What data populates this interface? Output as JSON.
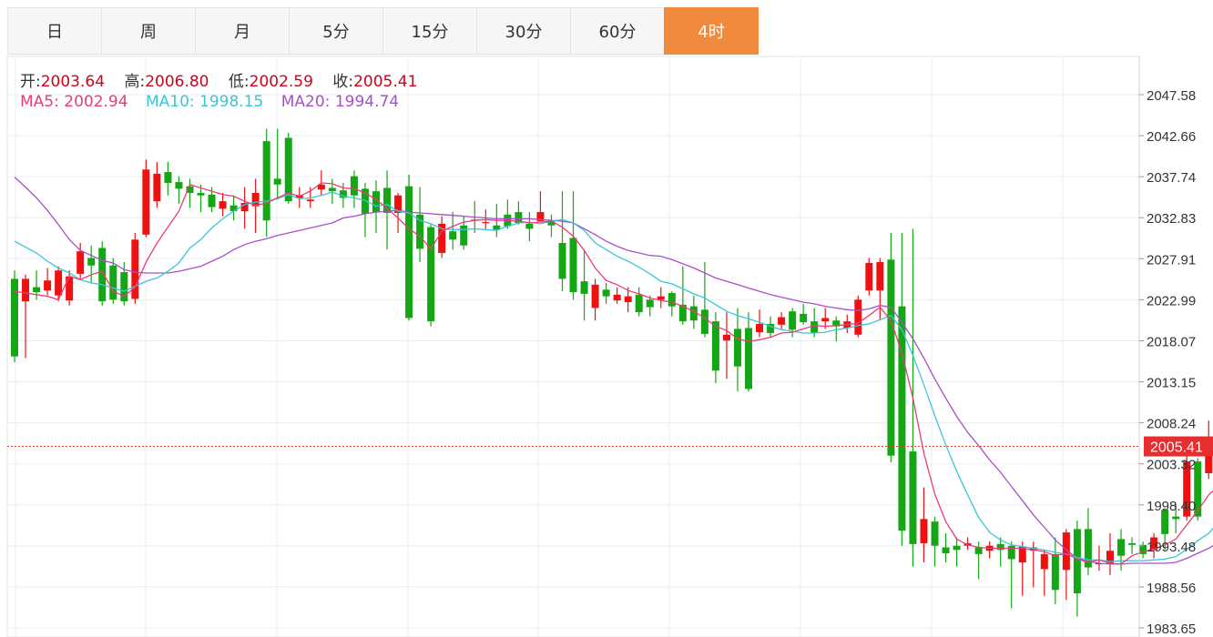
{
  "tabs": [
    {
      "label": "日",
      "active": false
    },
    {
      "label": "周",
      "active": false
    },
    {
      "label": "月",
      "active": false
    },
    {
      "label": "5分",
      "active": false
    },
    {
      "label": "15分",
      "active": false
    },
    {
      "label": "30分",
      "active": false
    },
    {
      "label": "60分",
      "active": false
    },
    {
      "label": "4时",
      "active": true
    }
  ],
  "ohlc_info": {
    "open_label": "开:",
    "open": "2003.64",
    "high_label": "高:",
    "high": "2006.80",
    "low_label": "低:",
    "low": "2002.59",
    "close_label": "收:",
    "close": "2005.41"
  },
  "ma_info": {
    "ma5_label": "MA5:",
    "ma5": "2002.94",
    "ma10_label": "MA10:",
    "ma10": "1998.15",
    "ma20_label": "MA20:",
    "ma20": "1994.74"
  },
  "colors": {
    "up": "#ee1111",
    "down": "#14a614",
    "ma5": "#ea3c7a",
    "ma10": "#39c6dc",
    "ma20": "#a94fc8",
    "accent": "#f08a3c",
    "price_line": "#e8432e"
  },
  "chart_data": {
    "type": "candlestick",
    "y_ticks": [
      "2047.58",
      "2042.66",
      "2037.74",
      "2032.83",
      "2027.91",
      "2022.99",
      "2018.07",
      "2013.15",
      "2008.24",
      "2003.32",
      "1998.40",
      "1993.48",
      "1988.56",
      "1983.65"
    ],
    "ylim": [
      1983.65,
      2047.58
    ],
    "current_price": "2005.41",
    "candles": [
      [
        2025.5,
        2016.2,
        2026.5,
        2015.5
      ],
      [
        2022.8,
        2025.5,
        2026.0,
        2016.0
      ],
      [
        2024.5,
        2023.9,
        2026.5,
        2023.0
      ],
      [
        2024.1,
        2025.3,
        2026.8,
        2023.5
      ],
      [
        2023.5,
        2026.5,
        2027.0,
        2022.8
      ],
      [
        2022.9,
        2025.8,
        2026.5,
        2022.3
      ],
      [
        2026.1,
        2028.8,
        2029.8,
        2025.5
      ],
      [
        2028.0,
        2027.1,
        2029.5,
        2025.0
      ],
      [
        2029.2,
        2022.8,
        2030.0,
        2022.3
      ],
      [
        2027.1,
        2023.0,
        2028.0,
        2022.5
      ],
      [
        2026.3,
        2022.8,
        2027.5,
        2022.3
      ],
      [
        2023.1,
        2030.2,
        2031.0,
        2022.5
      ],
      [
        2030.8,
        2038.6,
        2039.8,
        2030.5
      ],
      [
        2034.8,
        2038.1,
        2039.5,
        2034.0
      ],
      [
        2038.3,
        2037.0,
        2039.5,
        2035.5
      ],
      [
        2037.1,
        2036.3,
        2037.8,
        2034.5
      ],
      [
        2036.6,
        2035.8,
        2037.5,
        2034.0
      ],
      [
        2035.8,
        2035.5,
        2036.8,
        2033.5
      ],
      [
        2035.6,
        2034.1,
        2036.5,
        2033.5
      ],
      [
        2033.9,
        2034.8,
        2035.8,
        2033.0
      ],
      [
        2034.3,
        2033.6,
        2035.5,
        2032.5
      ],
      [
        2033.6,
        2034.6,
        2036.5,
        2031.5
      ],
      [
        2034.2,
        2035.8,
        2037.5,
        2031.0
      ],
      [
        2042.0,
        2032.5,
        2043.5,
        2030.5
      ],
      [
        2037.5,
        2036.8,
        2043.5,
        2035.0
      ],
      [
        2042.4,
        2034.8,
        2043.0,
        2034.5
      ],
      [
        2035.2,
        2035.5,
        2036.5,
        2034.0
      ],
      [
        2034.8,
        2035.0,
        2036.5,
        2034.0
      ],
      [
        2036.2,
        2036.8,
        2038.5,
        2035.5
      ],
      [
        2036.4,
        2036.0,
        2037.5,
        2034.5
      ],
      [
        2036.1,
        2035.2,
        2037.0,
        2034.0
      ],
      [
        2037.8,
        2035.5,
        2038.5,
        2034.0
      ],
      [
        2036.3,
        2033.3,
        2037.0,
        2030.5
      ],
      [
        2036.0,
        2033.5,
        2037.3,
        2031.0
      ],
      [
        2036.4,
        2033.4,
        2038.5,
        2029.0
      ],
      [
        2033.4,
        2035.5,
        2035.8,
        2031.0
      ],
      [
        2036.6,
        2020.8,
        2038.0,
        2020.5
      ],
      [
        2033.2,
        2029.1,
        2036.5,
        2027.5
      ],
      [
        2031.7,
        2020.4,
        2032.0,
        2019.8
      ],
      [
        2028.6,
        2032.1,
        2033.0,
        2028.0
      ],
      [
        2031.2,
        2030.2,
        2033.5,
        2029.0
      ],
      [
        2031.9,
        2029.5,
        2033.0,
        2029.0
      ],
      [
        2032.6,
        2032.5,
        2034.8,
        2031.0
      ],
      [
        2032.2,
        2032.3,
        2033.8,
        2031.5
      ],
      [
        2031.9,
        2031.4,
        2034.5,
        2030.5
      ],
      [
        2033.2,
        2031.8,
        2035.0,
        2031.5
      ],
      [
        2033.5,
        2032.2,
        2034.8,
        2032.0
      ],
      [
        2032.1,
        2031.5,
        2033.5,
        2030.0
      ],
      [
        2032.4,
        2033.5,
        2036.0,
        2032.5
      ],
      [
        2032.4,
        2031.9,
        2033.2,
        2030.5
      ],
      [
        2029.8,
        2025.5,
        2036.0,
        2024.0
      ],
      [
        2030.4,
        2023.9,
        2036.0,
        2023.0
      ],
      [
        2025.2,
        2023.7,
        2029.0,
        2020.5
      ],
      [
        2022.0,
        2024.8,
        2025.5,
        2020.5
      ],
      [
        2024.2,
        2023.4,
        2025.0,
        2022.5
      ],
      [
        2022.9,
        2023.6,
        2024.5,
        2022.5
      ],
      [
        2022.7,
        2023.4,
        2024.5,
        2021.5
      ],
      [
        2023.6,
        2021.5,
        2024.5,
        2021.0
      ],
      [
        2023.0,
        2022.1,
        2023.5,
        2021.0
      ],
      [
        2023.0,
        2023.4,
        2024.5,
        2022.0
      ],
      [
        2023.8,
        2022.2,
        2024.0,
        2021.0
      ],
      [
        2022.4,
        2020.4,
        2027.0,
        2020.0
      ],
      [
        2022.2,
        2020.5,
        2023.5,
        2019.5
      ],
      [
        2021.8,
        2018.9,
        2027.5,
        2018.5
      ],
      [
        2020.4,
        2014.5,
        2021.5,
        2013.0
      ],
      [
        2018.1,
        2018.8,
        2021.5,
        2013.5
      ],
      [
        2019.5,
        2015.0,
        2022.0,
        2012.0
      ],
      [
        2019.6,
        2012.3,
        2021.5,
        2012.0
      ],
      [
        2019.1,
        2020.1,
        2021.8,
        2018.5
      ],
      [
        2020.1,
        2019.0,
        2021.0,
        2018.5
      ],
      [
        2020.0,
        2020.9,
        2021.5,
        2019.5
      ],
      [
        2021.6,
        2019.4,
        2022.0,
        2018.5
      ],
      [
        2021.3,
        2020.3,
        2022.5,
        2020.0
      ],
      [
        2020.4,
        2019.0,
        2022.0,
        2018.5
      ],
      [
        2020.4,
        2020.8,
        2022.0,
        2019.5
      ],
      [
        2020.5,
        2019.8,
        2021.0,
        2018.0
      ],
      [
        2019.6,
        2020.4,
        2021.2,
        2019.0
      ],
      [
        2018.8,
        2023.0,
        2023.5,
        2018.5
      ],
      [
        2024.1,
        2027.4,
        2028.0,
        2023.5
      ],
      [
        2024.1,
        2027.5,
        2028.0,
        2020.5
      ],
      [
        2027.8,
        2004.3,
        2031.0,
        2003.5
      ],
      [
        2022.2,
        1995.3,
        2031.0,
        1993.5
      ],
      [
        2004.8,
        1993.7,
        2031.5,
        1991.0
      ],
      [
        1993.8,
        1996.7,
        2000.5,
        1991.5
      ],
      [
        1996.4,
        1993.5,
        1997.0,
        1991.0
      ],
      [
        1993.3,
        1992.6,
        1995.0,
        1991.5
      ],
      [
        1993.5,
        1993.0,
        1994.5,
        1991.0
      ],
      [
        1993.5,
        1993.8,
        1994.5,
        1993.0
      ],
      [
        1993.3,
        1992.5,
        1994.0,
        1989.5
      ],
      [
        1992.9,
        1993.5,
        1994.0,
        1992.0
      ],
      [
        1993.7,
        1993.0,
        1994.5,
        1991.0
      ],
      [
        1993.5,
        1991.9,
        1994.0,
        1986.0
      ],
      [
        1991.5,
        1993.4,
        1994.0,
        1987.5
      ],
      [
        1992.9,
        1993.3,
        1994.0,
        1988.5
      ],
      [
        1990.7,
        1992.5,
        1993.0,
        1987.5
      ],
      [
        1992.5,
        1988.2,
        1994.5,
        1986.5
      ],
      [
        1990.6,
        1995.1,
        1995.5,
        1987.0
      ],
      [
        1995.5,
        1987.8,
        1996.5,
        1985.0
      ],
      [
        1995.5,
        1990.9,
        1998.0,
        1990.0
      ],
      [
        1991.3,
        1991.4,
        1993.5,
        1990.5
      ],
      [
        1991.3,
        1992.9,
        1995.0,
        1990.0
      ],
      [
        1994.3,
        1992.3,
        1995.5,
        1990.5
      ],
      [
        1993.8,
        1993.6,
        1994.5,
        1992.5
      ],
      [
        1993.6,
        1992.5,
        1994.0,
        1992.0
      ],
      [
        1993.0,
        1994.5,
        1995.0,
        1992.0
      ],
      [
        1997.8,
        1994.9,
        1998.0,
        1993.0
      ],
      [
        1997.0,
        1996.7,
        1998.5,
        1995.0
      ],
      [
        1997.0,
        2003.6,
        2004.5,
        1996.5
      ],
      [
        2003.6,
        1997.0,
        2004.0,
        1996.5
      ],
      [
        2002.2,
        2006.1,
        2008.5,
        2001.5
      ],
      [
        2006.2,
        2003.6,
        2008.5,
        2001.5
      ],
      [
        2003.6,
        2005.4,
        2006.8,
        2002.6
      ]
    ],
    "ma5": [
      2024.0,
      2023.8,
      2023.6,
      2023.4,
      2023.0,
      2025.8,
      2025.4,
      2026.0,
      2026.4,
      2024.0,
      2023.4,
      2024.5,
      2027.5,
      2029.8,
      2031.7,
      2033.6,
      2036.8,
      2036.4,
      2036.0,
      2035.6,
      2035.4,
      2034.8,
      2034.3,
      2034.6,
      2035.2,
      2035.8,
      2035.4,
      2036.0,
      2037.0,
      2036.9,
      2036.4,
      2036.3,
      2035.8,
      2035.0,
      2034.0,
      2032.8,
      2031.5,
      2030.6,
      2029.1,
      2031.2,
      2031.8,
      2032.3,
      2032.5,
      2032.6,
      2032.5,
      2032.5,
      2032.4,
      2032.2,
      2032.3,
      2032.4,
      2031.7,
      2030.6,
      2028.9,
      2026.8,
      2025.3,
      2024.8,
      2024.1,
      2023.7,
      2023.2,
      2022.9,
      2022.7,
      2022.2,
      2021.6,
      2020.8,
      2019.8,
      2019.3,
      2018.3,
      2018.0,
      2018.2,
      2018.5,
      2019.0,
      2019.1,
      2019.5,
      2019.9,
      2019.8,
      2019.9,
      2020.0,
      2020.2,
      2021.1,
      2022.1,
      2020.5,
      2016.6,
      2011.2,
      2004.6,
      1999.7,
      1996.4,
      1994.3,
      1993.6,
      1993.3,
      1993.2,
      1993.2,
      1993.2,
      1993.2,
      1993.0,
      1992.8,
      1992.3,
      1992.6,
      1991.9,
      1991.5,
      1991.8,
      1991.4,
      1991.3,
      1992.3,
      1992.8,
      1993.1,
      1993.6,
      1994.3,
      1996.0,
      1997.7,
      1999.6,
      2000.8,
      2002.9
    ],
    "ma10": [
      2030.0,
      2029.3,
      2028.6,
      2027.6,
      2026.8,
      2026.2,
      2025.4,
      2025.0,
      2024.8,
      2024.4,
      2024.0,
      2024.6,
      2025.2,
      2025.6,
      2026.4,
      2027.4,
      2029.2,
      2030.2,
      2031.6,
      2032.7,
      2033.6,
      2034.4,
      2034.7,
      2034.8,
      2035.1,
      2035.6,
      2035.1,
      2035.2,
      2035.5,
      2035.9,
      2035.4,
      2035.2,
      2034.9,
      2034.2,
      2034.4,
      2033.6,
      2033.4,
      2032.5,
      2032.1,
      2031.5,
      2031.4,
      2031.4,
      2031.5,
      2031.4,
      2031.3,
      2031.8,
      2032.2,
      2032.3,
      2032.1,
      2032.4,
      2032.6,
      2032.2,
      2031.3,
      2029.8,
      2029.0,
      2028.2,
      2027.6,
      2026.9,
      2026.1,
      2025.2,
      2024.9,
      2024.3,
      2023.7,
      2023.2,
      2022.4,
      2021.6,
      2021.1,
      2020.7,
      2020.3,
      2019.8,
      2019.4,
      2019.2,
      2019.0,
      2019.0,
      2019.1,
      2019.4,
      2019.6,
      2019.9,
      2020.1,
      2020.6,
      2021.1,
      2019.4,
      2016.3,
      2012.8,
      2009.1,
      2005.6,
      2002.4,
      1999.6,
      1996.9,
      1995.1,
      1994.2,
      1993.6,
      1993.4,
      1993.2,
      1993.0,
      1992.7,
      1992.5,
      1992.1,
      1991.8,
      1991.8,
      1991.6,
      1991.7,
      1991.7,
      1991.7,
      1991.8,
      1991.9,
      1992.2,
      1993.1,
      1994.1,
      1995.0,
      1996.5,
      1998.2
    ],
    "ma20": [
      2037.7,
      2036.5,
      2035.2,
      2033.7,
      2032.0,
      2030.2,
      2028.9,
      2028.3,
      2027.7,
      2027.4,
      2026.6,
      2026.3,
      2026.2,
      2026.2,
      2026.2,
      2026.4,
      2026.7,
      2027.0,
      2027.6,
      2028.2,
      2029.0,
      2029.6,
      2030.0,
      2030.3,
      2030.7,
      2031.0,
      2031.3,
      2031.6,
      2031.9,
      2032.2,
      2032.8,
      2033.0,
      2033.3,
      2033.5,
      2033.6,
      2033.7,
      2033.5,
      2033.4,
      2033.3,
      2033.2,
      2033.1,
      2033.0,
      2032.9,
      2032.8,
      2032.7,
      2032.7,
      2032.7,
      2032.7,
      2032.6,
      2032.5,
      2032.4,
      2032.2,
      2031.5,
      2030.8,
      2030.0,
      2029.4,
      2028.9,
      2028.6,
      2028.3,
      2028.2,
      2027.8,
      2027.3,
      2026.8,
      2026.2,
      2025.6,
      2025.2,
      2024.8,
      2024.4,
      2024.0,
      2023.6,
      2023.3,
      2023.0,
      2022.7,
      2022.5,
      2022.2,
      2022.0,
      2021.8,
      2021.7,
      2021.9,
      2022.3,
      2022.1,
      2020.3,
      2018.3,
      2016.0,
      2013.5,
      2011.2,
      2009.0,
      2007.1,
      2005.5,
      2003.8,
      2002.3,
      2000.6,
      1998.9,
      1997.2,
      1995.7,
      1994.2,
      1993.0,
      1992.0,
      1991.6,
      1991.4,
      1991.3,
      1991.3,
      1991.4,
      1991.4,
      1991.4,
      1991.4,
      1991.5,
      1992.0,
      1992.6,
      1993.2,
      1994.0,
      1994.7
    ]
  }
}
